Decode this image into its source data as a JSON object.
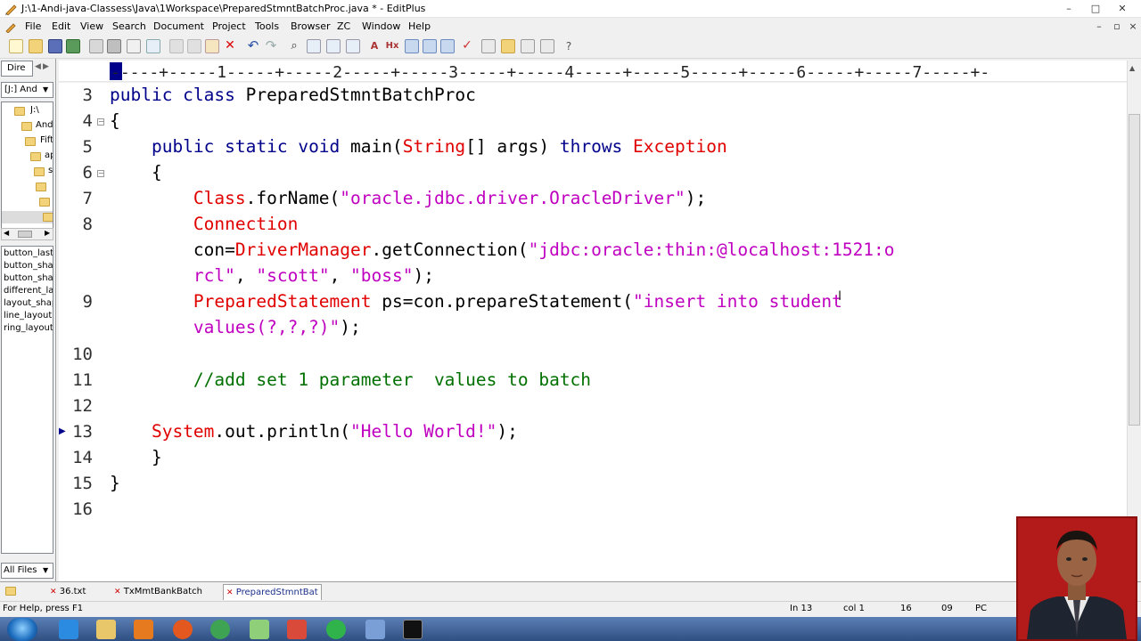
{
  "window": {
    "title": "J:\\1-Andi-java-Classess\\Java\\1Workspace\\PreparedStmntBatchProc.java * - EditPlus",
    "controls": [
      "–",
      "□",
      "✕"
    ],
    "inner_controls": [
      "–",
      "▫",
      "×"
    ]
  },
  "menu": [
    "File",
    "Edit",
    "View",
    "Search",
    "Document",
    "Project",
    "Tools",
    "Browser",
    "ZC",
    "Window",
    "Help"
  ],
  "left_panel": {
    "tab_label": "Dire",
    "drive_select": "[J:] And",
    "folders": [
      "J:\\",
      "Andi",
      "Fift",
      "ap",
      "s",
      "",
      ""
    ],
    "files": [
      "button_last",
      "button_sha",
      "button_sha",
      "different_la",
      "layout_shap",
      "line_layout",
      "ring_layout"
    ],
    "filter": "All Files"
  },
  "ruler": {
    "text": "-----+-----1-----+-----2-----+-----3-----+-----4-----+-----5-----+-----6-----+-----7-----+-"
  },
  "editor": {
    "lines": [
      {
        "n": "3",
        "segs": [
          {
            "c": "kw",
            "t": "public class "
          },
          {
            "c": "",
            "t": "PreparedStmntBatchProc"
          }
        ]
      },
      {
        "n": "4",
        "segs": [
          {
            "c": "",
            "t": "{"
          }
        ]
      },
      {
        "n": "5",
        "segs": [
          {
            "c": "",
            "t": "    "
          },
          {
            "c": "kw",
            "t": "public static void "
          },
          {
            "c": "",
            "t": "main("
          },
          {
            "c": "ty",
            "t": "String"
          },
          {
            "c": "",
            "t": "[] args) "
          },
          {
            "c": "kw",
            "t": "throws "
          },
          {
            "c": "ty",
            "t": "Exception"
          }
        ]
      },
      {
        "n": "6",
        "segs": [
          {
            "c": "",
            "t": "    {"
          }
        ]
      },
      {
        "n": "7",
        "segs": [
          {
            "c": "",
            "t": "        "
          },
          {
            "c": "ty",
            "t": "Class"
          },
          {
            "c": "",
            "t": ".forName("
          },
          {
            "c": "st",
            "t": "\"oracle.jdbc.driver.OracleDriver\""
          },
          {
            "c": "",
            "t": ");"
          }
        ]
      },
      {
        "n": "8",
        "segs": [
          {
            "c": "",
            "t": "        "
          },
          {
            "c": "ty",
            "t": "Connection"
          }
        ]
      },
      {
        "n": "",
        "segs": [
          {
            "c": "",
            "t": "        con="
          },
          {
            "c": "ty",
            "t": "DriverManager"
          },
          {
            "c": "",
            "t": ".getConnection("
          },
          {
            "c": "st",
            "t": "\"jdbc:oracle:thin:@localhost:1521:o"
          }
        ]
      },
      {
        "n": "",
        "segs": [
          {
            "c": "st",
            "t": "        rcl\""
          },
          {
            "c": "",
            "t": ", "
          },
          {
            "c": "st",
            "t": "\"scott\""
          },
          {
            "c": "",
            "t": ", "
          },
          {
            "c": "st",
            "t": "\"boss\""
          },
          {
            "c": "",
            "t": ");"
          }
        ]
      },
      {
        "n": "9",
        "segs": [
          {
            "c": "",
            "t": "        "
          },
          {
            "c": "ty",
            "t": "PreparedStatement"
          },
          {
            "c": "",
            "t": " ps=con.prepareStatement("
          },
          {
            "c": "st",
            "t": "\"insert into student"
          }
        ]
      },
      {
        "n": "",
        "segs": [
          {
            "c": "st",
            "t": "        values(?,?,?)\""
          },
          {
            "c": "",
            "t": ");"
          }
        ]
      },
      {
        "n": "10",
        "segs": []
      },
      {
        "n": "11",
        "segs": [
          {
            "c": "cm",
            "t": "        //add set 1 parameter  values to batch"
          }
        ]
      },
      {
        "n": "12",
        "segs": []
      },
      {
        "n": "13",
        "segs": [
          {
            "c": "",
            "t": "    "
          },
          {
            "c": "ty",
            "t": "System"
          },
          {
            "c": "",
            "t": ".out.println("
          },
          {
            "c": "st",
            "t": "\"Hello World!\""
          },
          {
            "c": "",
            "t": ");"
          }
        ]
      },
      {
        "n": "14",
        "segs": [
          {
            "c": "",
            "t": "    }"
          }
        ]
      },
      {
        "n": "15",
        "segs": [
          {
            "c": "",
            "t": "}"
          }
        ]
      },
      {
        "n": "16",
        "segs": []
      }
    ]
  },
  "doc_tabs": [
    "36.txt",
    "TxMmtBankBatch",
    "PreparedStmntBat"
  ],
  "status": {
    "help": "For Help, press F1",
    "line": "In 13",
    "col": "col 1",
    "v1": "16",
    "v2": "09",
    "mode": "PC"
  },
  "colors": {
    "keyword": "#00008b",
    "type": "#e00000",
    "string": "#c000c0",
    "comment": "#007000"
  }
}
